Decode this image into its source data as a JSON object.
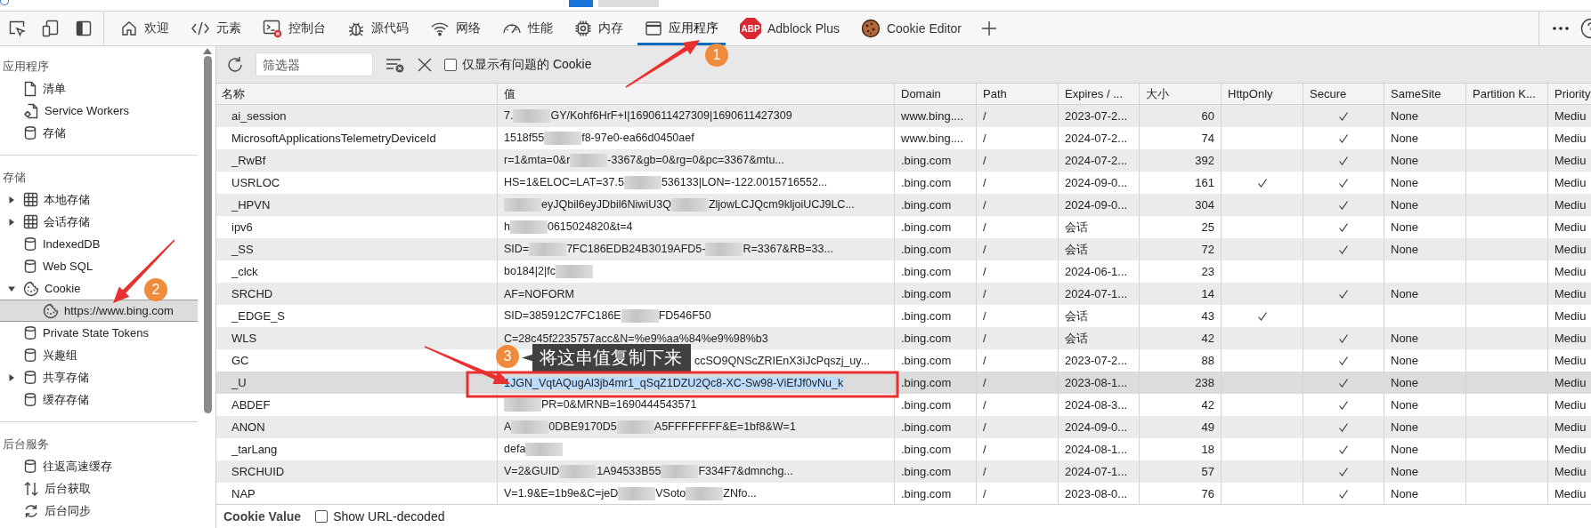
{
  "toolbar": {
    "tabs": [
      {
        "label": "欢迎",
        "kind": "home",
        "selected": false
      },
      {
        "label": "元素",
        "kind": "code",
        "selected": false
      },
      {
        "label": "控制台",
        "kind": "console",
        "selected": false
      },
      {
        "label": "源代码",
        "kind": "bug",
        "selected": false
      },
      {
        "label": "网络",
        "kind": "wifi",
        "selected": false
      },
      {
        "label": "性能",
        "kind": "gauge",
        "selected": false
      },
      {
        "label": "内存",
        "kind": "chip",
        "selected": false
      },
      {
        "label": "应用程序",
        "kind": "window",
        "selected": true
      },
      {
        "label": "Adblock Plus",
        "kind": "abp",
        "badge": "ABP",
        "selected": false
      },
      {
        "label": "Cookie Editor",
        "kind": "cookie",
        "selected": false
      }
    ]
  },
  "sidebar": {
    "sections": [
      {
        "title": "应用程序",
        "items": [
          {
            "label": "清单",
            "kind": "file",
            "selected": false
          },
          {
            "label": "Service Workers",
            "kind": "gear-file",
            "selected": false
          },
          {
            "label": "存储",
            "kind": "database",
            "selected": false
          }
        ]
      },
      {
        "title": "存储",
        "items": [
          {
            "label": "本地存储",
            "kind": "grid",
            "expanded": false,
            "selected": false
          },
          {
            "label": "会话存储",
            "kind": "grid",
            "expanded": false,
            "selected": false
          },
          {
            "label": "IndexedDB",
            "kind": "database",
            "selected": false
          },
          {
            "label": "Web SQL",
            "kind": "database",
            "selected": false
          },
          {
            "label": "Cookie",
            "kind": "cookie",
            "expanded": true,
            "selected": false,
            "children": [
              {
                "label": "https://www.bing.com",
                "kind": "cookie",
                "selected": true
              }
            ]
          },
          {
            "label": "Private State Tokens",
            "kind": "database",
            "selected": false
          },
          {
            "label": "兴趣组",
            "kind": "database",
            "selected": false
          },
          {
            "label": "共享存储",
            "kind": "database",
            "expanded": false,
            "selected": false
          },
          {
            "label": "缓存存储",
            "kind": "database",
            "selected": false
          }
        ]
      },
      {
        "title": "后台服务",
        "items": [
          {
            "label": "往返高速缓存",
            "kind": "database",
            "selected": false
          },
          {
            "label": "后台获取",
            "kind": "updown",
            "selected": false
          },
          {
            "label": "后台同步",
            "kind": "sync",
            "selected": false
          }
        ]
      }
    ]
  },
  "cookies": {
    "filter": {
      "placeholder": "筛选器"
    },
    "only_issues": {
      "label": "仅显示有问题的 Cookie",
      "checked": false
    },
    "columns": [
      "名称",
      "值",
      "Domain",
      "Path",
      "Expires / ...",
      "大小",
      "HttpOnly",
      "Secure",
      "SameSite",
      "Partition K...",
      "Priority"
    ],
    "rows": [
      {
        "name": "ai_session",
        "value": [
          {
            "kind": "text",
            "text": "7."
          },
          {
            "kind": "blur"
          },
          {
            "kind": "text",
            "text": "GY/Kohf6HrF+I|1690611427309|1690611427309"
          }
        ],
        "domain": "www.bing....",
        "path": "/",
        "expires": "2023-07-2...",
        "size": "60",
        "httponly": false,
        "secure": true,
        "samesite": "None",
        "priority": "Mediu",
        "selected": false
      },
      {
        "name": "MicrosoftApplicationsTelemetryDeviceId",
        "value": [
          {
            "kind": "text",
            "text": "1518f55"
          },
          {
            "kind": "blur"
          },
          {
            "kind": "text",
            "text": "f8-97e0-ea66d0450aef"
          }
        ],
        "domain": "www.bing....",
        "path": "/",
        "expires": "2024-07-2...",
        "size": "74",
        "httponly": false,
        "secure": true,
        "samesite": "None",
        "priority": "Mediu",
        "selected": false
      },
      {
        "name": "_RwBf",
        "value": [
          {
            "kind": "text",
            "text": "r=1&mta=0&r"
          },
          {
            "kind": "blur"
          },
          {
            "kind": "text",
            "text": "-3367&gb=0&rg=0&pc=3367&mtu..."
          }
        ],
        "domain": ".bing.com",
        "path": "/",
        "expires": "2024-07-2...",
        "size": "392",
        "httponly": false,
        "secure": true,
        "samesite": "None",
        "priority": "Mediu",
        "selected": false
      },
      {
        "name": "USRLOC",
        "value": [
          {
            "kind": "text",
            "text": "HS=1&ELOC=LAT=37.5"
          },
          {
            "kind": "blur"
          },
          {
            "kind": "text",
            "text": "536133|LON=-122.0015716552..."
          }
        ],
        "domain": ".bing.com",
        "path": "/",
        "expires": "2024-09-0...",
        "size": "161",
        "httponly": true,
        "secure": true,
        "samesite": "None",
        "priority": "Mediu",
        "selected": false
      },
      {
        "name": "_HPVN",
        "value": [
          {
            "kind": "blur"
          },
          {
            "kind": "text",
            "text": "eyJQbil6eyJDbil6NiwiU3Q"
          },
          {
            "kind": "blur"
          },
          {
            "kind": "text",
            "text": "ZljowLCJQcm9kljoiUCJ9LC..."
          }
        ],
        "domain": ".bing.com",
        "path": "/",
        "expires": "2024-09-0...",
        "size": "304",
        "httponly": false,
        "secure": true,
        "samesite": "None",
        "priority": "Mediu",
        "selected": false
      },
      {
        "name": "ipv6",
        "value": [
          {
            "kind": "text",
            "text": "h"
          },
          {
            "kind": "blur"
          },
          {
            "kind": "text",
            "text": "0615024820&t=4"
          }
        ],
        "domain": ".bing.com",
        "path": "/",
        "expires": "会话",
        "size": "25",
        "httponly": false,
        "secure": true,
        "samesite": "None",
        "priority": "Mediu",
        "selected": false
      },
      {
        "name": "_SS",
        "value": [
          {
            "kind": "text",
            "text": "SID="
          },
          {
            "kind": "blur"
          },
          {
            "kind": "text",
            "text": "7FC186EDB24B3019AFD5-"
          },
          {
            "kind": "blur"
          },
          {
            "kind": "text",
            "text": "R=3367&RB=33..."
          }
        ],
        "domain": ".bing.com",
        "path": "/",
        "expires": "会话",
        "size": "72",
        "httponly": false,
        "secure": true,
        "samesite": "None",
        "priority": "Mediu",
        "selected": false
      },
      {
        "name": "_clck",
        "value": [
          {
            "kind": "text",
            "text": "bo184|2|fc"
          },
          {
            "kind": "blur"
          }
        ],
        "domain": ".bing.com",
        "path": "/",
        "expires": "2024-06-1...",
        "size": "23",
        "httponly": false,
        "secure": false,
        "priority": "Mediu",
        "selected": false
      },
      {
        "name": "SRCHD",
        "value": [
          {
            "kind": "text",
            "text": "AF=NOFORM"
          }
        ],
        "domain": ".bing.com",
        "path": "/",
        "expires": "2024-07-1...",
        "size": "14",
        "httponly": false,
        "secure": true,
        "samesite": "None",
        "priority": "Mediu",
        "selected": false
      },
      {
        "name": "_EDGE_S",
        "value": [
          {
            "kind": "text",
            "text": "SID=385912C7FC186E"
          },
          {
            "kind": "blur"
          },
          {
            "kind": "text",
            "text": "FD546F50"
          }
        ],
        "domain": ".bing.com",
        "path": "/",
        "expires": "会话",
        "size": "43",
        "httponly": true,
        "secure": false,
        "priority": "Mediu",
        "selected": false
      },
      {
        "name": "WLS",
        "value": [
          {
            "kind": "text",
            "text": "C=28c45f2235757acc&N=%e9%aa%84%e9%98%b3"
          }
        ],
        "domain": ".bing.com",
        "path": "/",
        "expires": "会话",
        "size": "42",
        "httponly": false,
        "secure": true,
        "samesite": "None",
        "priority": "Mediu",
        "selected": false
      },
      {
        "name": "GC",
        "value": [
          {
            "kind": "text",
            "text": "ccSO9QNScZRIEnX3iJcPqszj_uy..."
          }
        ],
        "domain": ".bing.com",
        "path": "/",
        "expires": "2023-07-2...",
        "size": "88",
        "httponly": false,
        "secure": true,
        "samesite": "None",
        "priority": "Mediu",
        "selected": false
      },
      {
        "name": "_U",
        "value": [
          {
            "kind": "text",
            "text": "1JGN_VqtAQugAl3jb4mr1_qSqZ1DZU2Qc8-XC-Sw98-ViEfJf0vNu_k"
          }
        ],
        "domain": ".bing.com",
        "path": "/",
        "expires": "2023-08-1...",
        "size": "238",
        "httponly": false,
        "secure": true,
        "samesite": "None",
        "priority": "Mediu",
        "selected": true
      },
      {
        "name": "ABDEF",
        "value": [
          {
            "kind": "blur"
          },
          {
            "kind": "text",
            "text": "PR=0&MRNB=1690444543571"
          }
        ],
        "domain": ".bing.com",
        "path": "/",
        "expires": "2024-08-3...",
        "size": "42",
        "httponly": false,
        "secure": true,
        "samesite": "None",
        "priority": "Mediu",
        "selected": false
      },
      {
        "name": "ANON",
        "value": [
          {
            "kind": "text",
            "text": "A"
          },
          {
            "kind": "blur"
          },
          {
            "kind": "text",
            "text": "0DBE9170D5"
          },
          {
            "kind": "blur"
          },
          {
            "kind": "text",
            "text": "A5FFFFFFFF&E=1bf8&W=1"
          }
        ],
        "domain": ".bing.com",
        "path": "/",
        "expires": "2024-09-0...",
        "size": "49",
        "httponly": false,
        "secure": true,
        "samesite": "None",
        "priority": "Mediu",
        "selected": false
      },
      {
        "name": "_tarLang",
        "value": [
          {
            "kind": "text",
            "text": "defa"
          },
          {
            "kind": "blur"
          }
        ],
        "domain": ".bing.com",
        "path": "/",
        "expires": "2024-08-1...",
        "size": "18",
        "httponly": false,
        "secure": true,
        "samesite": "None",
        "priority": "Mediu",
        "selected": false
      },
      {
        "name": "SRCHUID",
        "value": [
          {
            "kind": "text",
            "text": "V=2&GUID"
          },
          {
            "kind": "blur"
          },
          {
            "kind": "text",
            "text": "1A94533B55"
          },
          {
            "kind": "blur"
          },
          {
            "kind": "text",
            "text": "F334F7&dmnchg..."
          }
        ],
        "domain": ".bing.com",
        "path": "/",
        "expires": "2024-07-1...",
        "size": "57",
        "httponly": false,
        "secure": true,
        "samesite": "None",
        "priority": "Mediu",
        "selected": false
      },
      {
        "name": "NAP",
        "value": [
          {
            "kind": "text",
            "text": "V=1.9&E=1b9e&C=jeD"
          },
          {
            "kind": "blur"
          },
          {
            "kind": "text",
            "text": "VSoto"
          },
          {
            "kind": "blur"
          },
          {
            "kind": "text",
            "text": "ZNfo..."
          }
        ],
        "domain": ".bing.com",
        "path": "/",
        "expires": "2023-08-0...",
        "size": "76",
        "httponly": false,
        "secure": true,
        "samesite": "None",
        "priority": "Mediu",
        "selected": false
      }
    ],
    "footer": {
      "title": "Cookie Value",
      "url_decoded": {
        "label": "Show URL-decoded",
        "checked": false
      }
    }
  },
  "annotations": [
    {
      "number": "1"
    },
    {
      "number": "2"
    },
    {
      "number": "3",
      "label": "将这串值复制下来",
      "framed": true
    }
  ]
}
